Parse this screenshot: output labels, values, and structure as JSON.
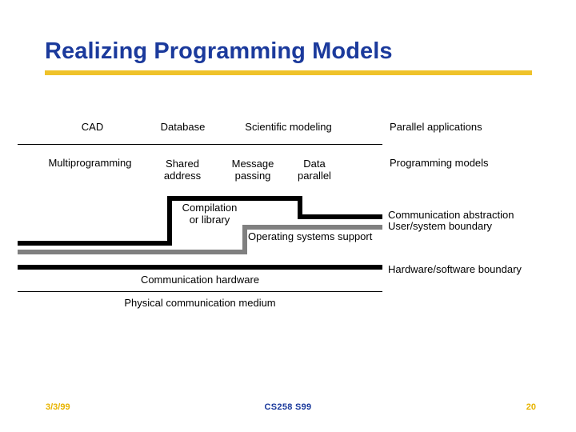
{
  "slide": {
    "title": "Realizing Programming Models",
    "accent_color": "#efc22a",
    "title_color": "#1b3a9c",
    "line_black": "#000000",
    "line_gray": "#808080"
  },
  "diagram": {
    "applications_row": [
      {
        "label": "CAD"
      },
      {
        "label": "Database"
      },
      {
        "label": "Scientific modeling"
      }
    ],
    "applications_caption": "Parallel applications",
    "models_row": [
      {
        "label": "Multiprogramming"
      },
      {
        "label_line1": "Shared",
        "label_line2": "address"
      },
      {
        "label_line1": "Message",
        "label_line2": "passing"
      },
      {
        "label_line1": "Data",
        "label_line2": "parallel"
      }
    ],
    "models_caption": "Programming models",
    "compilation_line1": "Compilation",
    "compilation_line2": "or library",
    "os_support": "Operating systems support",
    "communication_abstraction": "Communication abstraction",
    "user_system_boundary": "User/system boundary",
    "hardware_software_boundary": "Hardware/software boundary",
    "communication_hardware": "Communication hardware",
    "physical_medium": "Physical communication medium"
  },
  "footer": {
    "date": "3/3/99",
    "course": "CS258 S99",
    "page": "20"
  }
}
